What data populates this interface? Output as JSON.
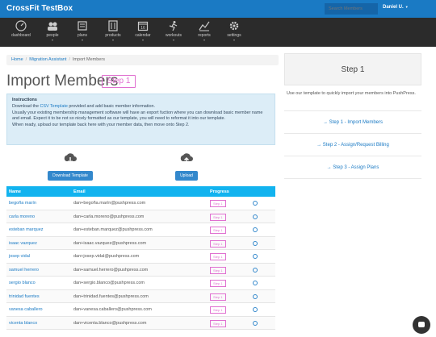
{
  "app": {
    "brand": "CrossFit TestBox",
    "search_placeholder": "Search Members",
    "user": "Daniel U."
  },
  "nav": [
    {
      "label": "dashboard",
      "icon": "dashboard-icon",
      "caret": ""
    },
    {
      "label": "people",
      "icon": "people-icon",
      "caret": "▾"
    },
    {
      "label": "plans",
      "icon": "plans-icon",
      "caret": "▾"
    },
    {
      "label": "products",
      "icon": "products-icon",
      "caret": "▾"
    },
    {
      "label": "calendar",
      "icon": "calendar-icon",
      "caret": "▾"
    },
    {
      "label": "workouts",
      "icon": "workouts-icon",
      "caret": "▾"
    },
    {
      "label": "reports",
      "icon": "reports-icon",
      "caret": "▾"
    },
    {
      "label": "settings",
      "icon": "gear-icon",
      "caret": "▾"
    }
  ],
  "breadcrumb": {
    "home": "Home",
    "parent": "Migration Assistant",
    "current": "Import Members",
    "sep": "/"
  },
  "page": {
    "title": "Import Members",
    "step_badge": "Step 1"
  },
  "instructions": {
    "heading": "Instructions",
    "line1_pre": "Download the ",
    "line1_link": "CSV Template",
    "line1_post": " provided and add basic member information.",
    "line2": "Usually your existing membership management software will have an export fuction where you can download basic member name and email. Expect it to be not so nicely formatted as our template, you will need to reformat it into our template.",
    "line3": "When ready, upload our template back here with your member data, then move onto Step 2."
  },
  "actions": {
    "download_label": "Download Template",
    "upload_label": "Upload"
  },
  "table": {
    "headers": {
      "name": "Name",
      "email": "Email",
      "progress": "Progress"
    },
    "rows": [
      {
        "name": "begoña marín",
        "email": "dan+begoña.marín@pushpress.com",
        "step": "Step 1"
      },
      {
        "name": "carla moreno",
        "email": "dan+carla.moreno@pushpress.com",
        "step": "Step 1"
      },
      {
        "name": "esteban marquez",
        "email": "dan+esteban.marquez@pushpress.com",
        "step": "Step 1"
      },
      {
        "name": "isaac vazquez",
        "email": "dan+isaac.vazquez@pushpress.com",
        "step": "Step 1"
      },
      {
        "name": "josep vidal",
        "email": "dan+josep.vidal@pushpress.com",
        "step": "Step 1"
      },
      {
        "name": "samuel herrero",
        "email": "dan+samuel.herrero@pushpress.com",
        "step": "Step 1"
      },
      {
        "name": "sergio blanco",
        "email": "dan+sergio.blanco@pushpress.com",
        "step": "Step 1"
      },
      {
        "name": "trinidad fuentes",
        "email": "dan+trinidad.fuentes@pushpress.com",
        "step": "Step 1"
      },
      {
        "name": "vanesa caballero",
        "email": "dan+vanesa.caballero@pushpress.com",
        "step": "Step 1"
      },
      {
        "name": "vicenta blanco",
        "email": "dan+vicenta.blanco@pushpress.com",
        "step": "Step 1"
      }
    ]
  },
  "sidebar": {
    "heading": "Step 1",
    "description": "Use our template to quickly import your members into PushPress.",
    "links": [
      "→ Step 1 - Import Members",
      "→ Step 2 - Assign/Request Billing",
      "→ Step 3 - Assign Plans"
    ]
  },
  "colors": {
    "topbar": "#1a7ac4",
    "navbar": "#2b2b2b",
    "accent_pink": "#e070d0",
    "table_header": "#12b3ef"
  }
}
